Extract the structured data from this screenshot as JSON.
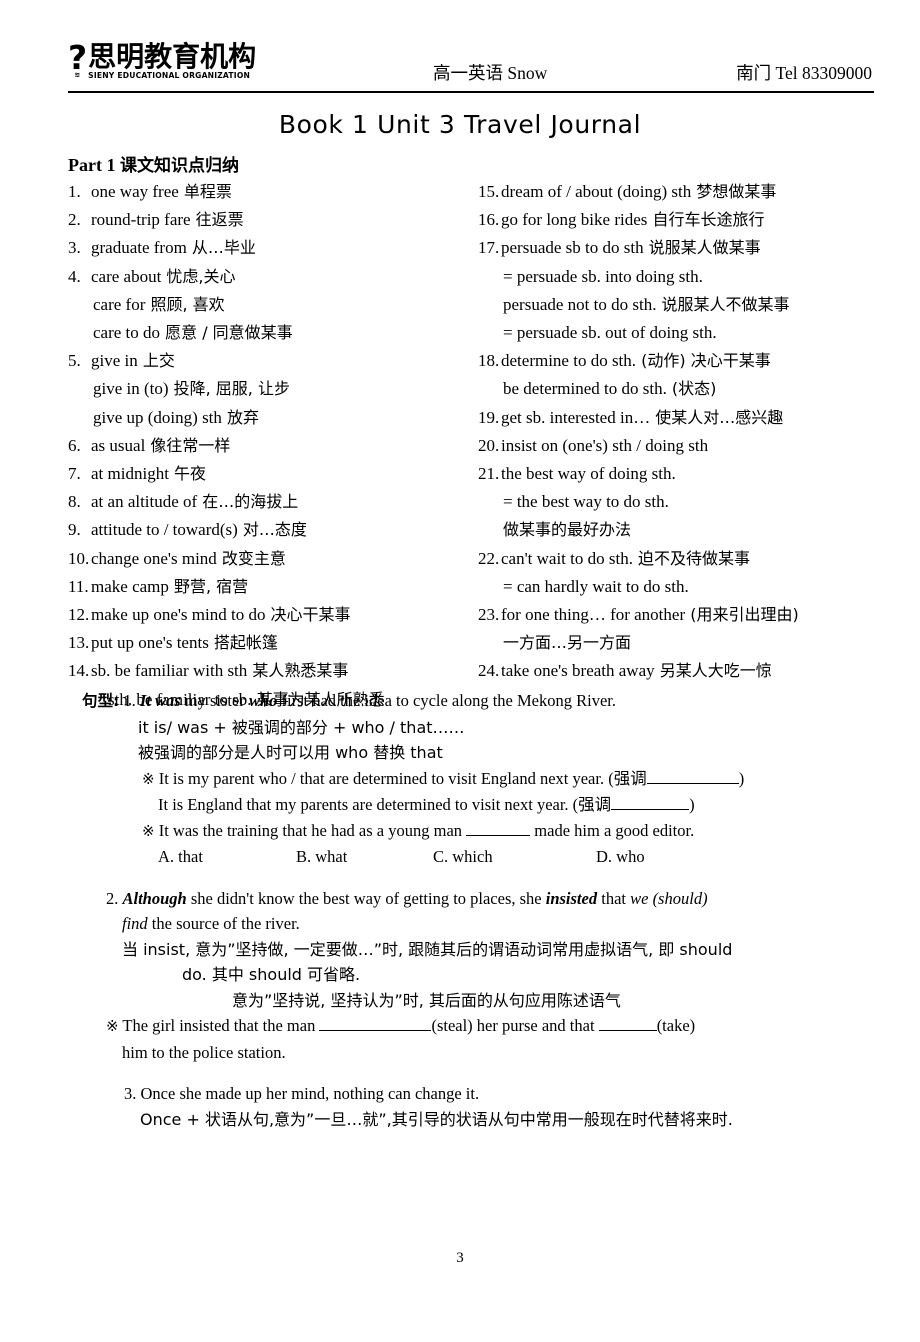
{
  "header": {
    "logo_mark": "?",
    "logo_mark_sub": "≋",
    "logo_cn": "思明教育机构",
    "logo_en": "SIENY EDUCATIONAL ORGANIZATION",
    "center": "高一英语 Snow",
    "right": "南门 Tel 83309000"
  },
  "title": "Book 1 Unit 3 Travel Journal",
  "part": {
    "label": "Part 1",
    "cn": "课文知识点归纳"
  },
  "vocab": {
    "left": [
      {
        "num": "1.",
        "en": "one way free",
        "cn": "单程票"
      },
      {
        "num": "2.",
        "en": "round-trip fare",
        "cn": "往返票"
      },
      {
        "num": "3.",
        "en": "graduate from",
        "cn": "从…毕业"
      },
      {
        "num": "4.",
        "en": "care about",
        "cn": "忧虑,关心"
      },
      {
        "num": "",
        "en": "care for",
        "cn": "照顾, 喜欢",
        "indent": 1
      },
      {
        "num": "",
        "en": "care to do",
        "cn": "愿意 / 同意做某事",
        "indent": 1
      },
      {
        "num": "5.",
        "en": "give in",
        "cn": "上交"
      },
      {
        "num": "",
        "en": "give in (to)",
        "cn": "投降, 屈服, 让步",
        "indent": 1
      },
      {
        "num": "",
        "en": "give up (doing) sth",
        "cn": "放弃",
        "indent": 1
      },
      {
        "num": "6.",
        "en": "as usual",
        "cn": "像往常一样"
      },
      {
        "num": "7.",
        "en": "at midnight",
        "cn": "午夜"
      },
      {
        "num": "8.",
        "en": "at an altitude of",
        "cn": "在…的海拔上"
      },
      {
        "num": "9.",
        "en": "attitude to / toward(s)",
        "cn": "对…态度"
      },
      {
        "num": "10.",
        "en": "change one's mind",
        "cn": "改变主意"
      },
      {
        "num": "11.",
        "en": "make camp",
        "cn": "野营, 宿营"
      },
      {
        "num": "12.",
        "en": "make up one's mind to do",
        "cn": "决心干某事"
      },
      {
        "num": "13.",
        "en": "put up one's tents",
        "cn": "搭起帐篷"
      },
      {
        "num": "14.",
        "en": "sb. be familiar with sth",
        "cn": "某人熟悉某事"
      },
      {
        "num": "",
        "en": "sth. be familiar to sb.",
        "cn": "某事为某人所熟悉",
        "indent": 2
      }
    ],
    "right": [
      {
        "num": "15.",
        "en": "dream of / about (doing) sth",
        "cn": "梦想做某事"
      },
      {
        "num": "16.",
        "en": "go for long bike rides",
        "cn": "自行车长途旅行"
      },
      {
        "num": "17.",
        "en": "persuade sb to do sth",
        "cn": "说服某人做某事"
      },
      {
        "num": "",
        "en": "= persuade sb. into doing sth.",
        "cn": "",
        "indent": 1
      },
      {
        "num": "",
        "en": "persuade not to do sth.",
        "cn": "说服某人不做某事",
        "indent": 1
      },
      {
        "num": "",
        "en": "= persuade sb. out of doing sth.",
        "cn": "",
        "indent": 1
      },
      {
        "num": "18.",
        "en": "determine to do sth.",
        "cn": "(动作) 决心干某事"
      },
      {
        "num": "",
        "en": "be determined to do sth.",
        "cn": "(状态)",
        "indent": 1
      },
      {
        "num": "19.",
        "en": "get sb. interested in…",
        "cn": "使某人对…感兴趣"
      },
      {
        "num": "20.",
        "en": "insist on (one's) sth / doing sth",
        "cn": ""
      },
      {
        "num": "21.",
        "en": "the best way of doing sth.",
        "cn": ""
      },
      {
        "num": "",
        "en": "= the best way to do sth.",
        "cn": "",
        "indent": 1
      },
      {
        "num": "",
        "en": "",
        "cn": "做某事的最好办法",
        "indent": 1
      },
      {
        "num": "22.",
        "en": "can't wait to do sth.",
        "cn": "迫不及待做某事"
      },
      {
        "num": "",
        "en": "= can hardly wait to do sth.",
        "cn": "",
        "indent": 1
      },
      {
        "num": "23.",
        "en": "for one thing… for another",
        "cn": "(用来引出理由)"
      },
      {
        "num": "",
        "en": "",
        "cn": "一方面…另一方面",
        "indent": 1
      },
      {
        "num": "24.",
        "en": "take one's breath away",
        "cn": "另某人大吃一惊"
      }
    ]
  },
  "patterns": {
    "label": "句型:",
    "item1": {
      "num": "1.",
      "s_a": "It was",
      "s_b": " my sister ",
      "s_c": "who",
      "s_d": " first had the idea to cycle along the Mekong River.",
      "formula": "it is/ was +  被强调的部分  + who / that……",
      "note": "被强调的部分是人时可以用 who 替换 that",
      "ex1_mark": "※",
      "ex1_text": "It is my parent who / that are determined to visit England next year. (强调",
      "ex1_tail": ")",
      "ex2_text": "It is England that my parents are determined to visit next year. (强调",
      "ex2_tail": ")",
      "ex3_mark": "※",
      "ex3_a": "It was the training that he had as a young man ",
      "ex3_b": " made him a good editor.",
      "choices": [
        "A. that",
        "B. what",
        "C. which",
        "D. who"
      ]
    },
    "item2": {
      "num": "2.",
      "s_a": "Although",
      "s_b": " she didn't know the best way of getting to places, she ",
      "s_c": "insisted",
      "s_d": " that ",
      "s_e": "we (should)",
      "s_f": "find",
      "s_g": " the source of the river.",
      "note1": "当 insist, 意为”坚持做, 一定要做…”时, 跟随其后的谓语动词常用虚拟语气, 即 should",
      "note2": "do. 其中 should 可省略.",
      "note3": "意为”坚持说, 坚持认为”时, 其后面的从句应用陈述语气",
      "ex_mark": "※",
      "ex_a": "The girl insisted that the man ",
      "ex_b": "(steal) her purse and that ",
      "ex_c": "(take)",
      "ex_d": "him to the police station."
    },
    "item3": {
      "num": "3.",
      "sentence": "Once she made up her mind, nothing can change it.",
      "note": "Once +  状语从句,意为”一旦…就”,其引导的状语从句中常用一般现在时代替将来时."
    }
  },
  "page_number": "3"
}
